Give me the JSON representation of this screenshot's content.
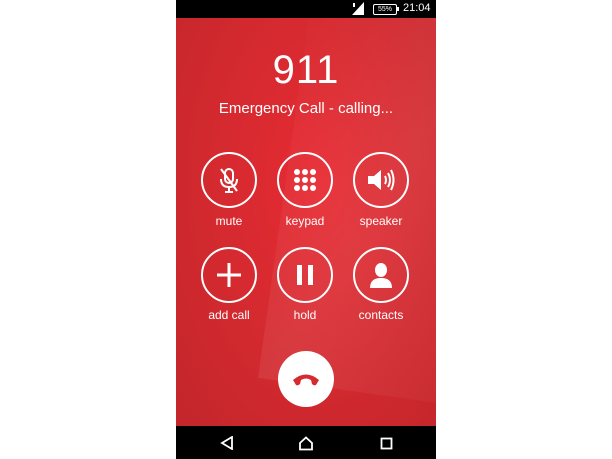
{
  "status_bar": {
    "battery": "55%",
    "time": "21:04",
    "icons": [
      "signal-icon",
      "battery-icon"
    ]
  },
  "call": {
    "number": "911",
    "status": "Emergency Call - calling..."
  },
  "controls": {
    "mute": {
      "label": "mute",
      "icon": "mute-microphone-icon"
    },
    "keypad": {
      "label": "keypad",
      "icon": "keypad-icon"
    },
    "speaker": {
      "label": "speaker",
      "icon": "speaker-icon"
    },
    "add_call": {
      "label": "add call",
      "icon": "plus-icon"
    },
    "hold": {
      "label": "hold",
      "icon": "pause-icon"
    },
    "contacts": {
      "label": "contacts",
      "icon": "contact-person-icon"
    }
  },
  "end_call": {
    "icon": "end-call-handset-icon"
  },
  "nav_bar": {
    "icons": [
      "back-icon",
      "home-icon",
      "recents-icon"
    ]
  },
  "colors": {
    "background": "#d62a30",
    "end_call_icon": "#d62a30",
    "foreground": "#ffffff"
  }
}
